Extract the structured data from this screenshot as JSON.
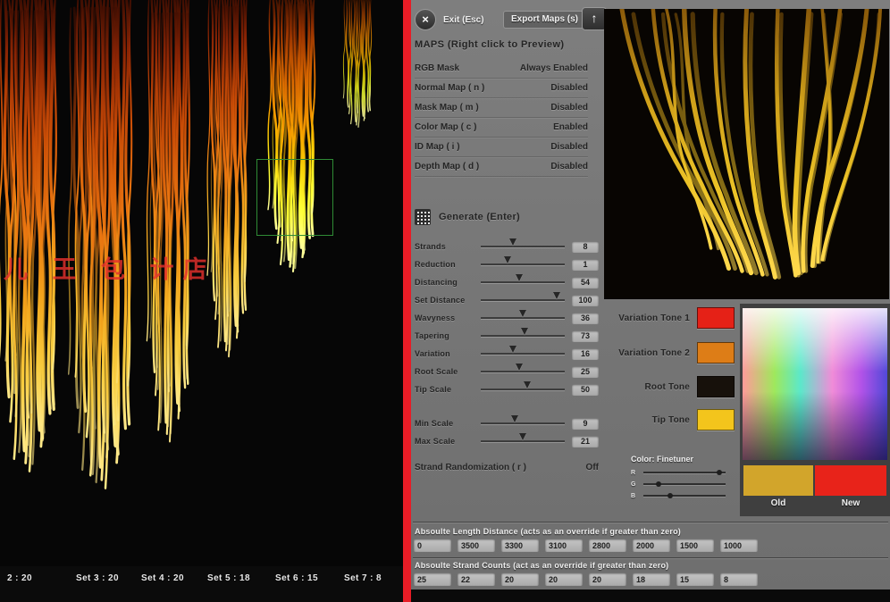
{
  "colors": {
    "divider_red": "#e81c26",
    "variation_tone_1": "#e52117",
    "variation_tone_2": "#dd7d17",
    "root_tone": "#17110b",
    "tip_tone": "#f3c51c",
    "old_swatch": "#d2a52b",
    "new_swatch": "#e8231a"
  },
  "topbar": {
    "close_glyph": "×",
    "exit": "Exit (Esc)",
    "export": "Export Maps (s)",
    "up_glyph": "↑"
  },
  "maps": {
    "header": "MAPS (Right click to Preview)",
    "rows": [
      {
        "label": "RGB Mask",
        "status": "Always Enabled"
      },
      {
        "label": "Normal Map ( n )",
        "status": "Disabled"
      },
      {
        "label": "Mask Map ( m )",
        "status": "Disabled"
      },
      {
        "label": "Color Map ( c )",
        "status": "Enabled"
      },
      {
        "label": "ID Map ( i )",
        "status": "Disabled"
      },
      {
        "label": "Depth Map ( d )",
        "status": "Disabled"
      }
    ]
  },
  "generate": {
    "label": "Generate (Enter)"
  },
  "sliders": [
    {
      "label": "Strands",
      "value": "8",
      "pct": 38
    },
    {
      "label": "Reduction",
      "value": "1",
      "pct": 32
    },
    {
      "label": "Distancing",
      "value": "54",
      "pct": 46
    },
    {
      "label": "Set Distance",
      "value": "100",
      "pct": 90
    },
    {
      "label": "Wavyness",
      "value": "36",
      "pct": 50
    },
    {
      "label": "Tapering",
      "value": "73",
      "pct": 52
    },
    {
      "label": "Variation",
      "value": "16",
      "pct": 38
    },
    {
      "label": "Root Scale",
      "value": "25",
      "pct": 46
    },
    {
      "label": "Tip Scale",
      "value": "50",
      "pct": 55
    }
  ],
  "scale_sliders": [
    {
      "label": "Min Scale",
      "value": "9",
      "pct": 40
    },
    {
      "label": "Max Scale",
      "value": "21",
      "pct": 50
    }
  ],
  "randomization": {
    "label": "Strand Randomization ( r )",
    "value": "Off"
  },
  "tones": [
    {
      "label": "Variation Tone 1",
      "color": "#e52117"
    },
    {
      "label": "Variation Tone 2",
      "color": "#dd7d17"
    },
    {
      "label": "Root Tone",
      "color": "#17110b"
    },
    {
      "label": "Tip Tone",
      "color": "#f3c51c"
    }
  ],
  "finetuner": {
    "label": "Color: Finetuner",
    "channels": [
      {
        "label": "R",
        "pct": 92
      },
      {
        "label": "G",
        "pct": 18
      },
      {
        "label": "B",
        "pct": 33
      }
    ]
  },
  "swatches": {
    "old": {
      "label": "Old",
      "color": "#d2a52b"
    },
    "new": {
      "label": "New",
      "color": "#e8231a"
    }
  },
  "length_override": {
    "label": "Absoulte Length Distance (acts as an override if greater than zero)",
    "values": [
      "0",
      "3500",
      "3300",
      "3100",
      "2800",
      "2000",
      "1500",
      "1000"
    ]
  },
  "count_override": {
    "label": "Absoulte Strand Counts (act as an override if greater than zero)",
    "values": [
      "25",
      "22",
      "20",
      "20",
      "20",
      "18",
      "15",
      "8"
    ]
  },
  "viewport": {
    "watermark": "儿 王 包 计店",
    "set_labels": [
      "2 : 20",
      "Set 3 : 20",
      "Set 4 : 20",
      "Set 5 : 18",
      "Set 6 : 15",
      "Set 7 : 8"
    ]
  }
}
